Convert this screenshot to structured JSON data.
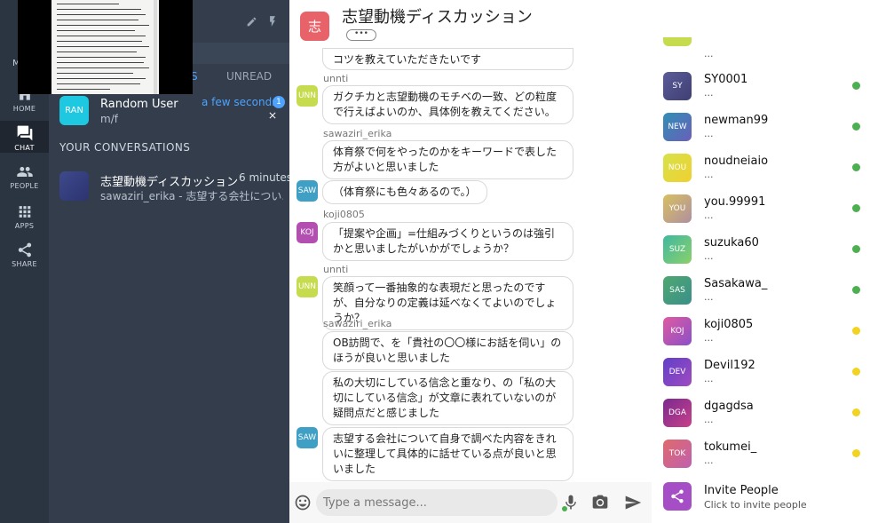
{
  "rail": {
    "partial_label": "M",
    "items": [
      {
        "label": "HOME",
        "icon": "home-icon"
      },
      {
        "label": "CHAT",
        "icon": "chat-icon"
      },
      {
        "label": "PEOPLE",
        "icon": "people-icon"
      },
      {
        "label": "APPS",
        "icon": "apps-icon"
      },
      {
        "label": "SHARE",
        "icon": "share-icon"
      }
    ]
  },
  "conv_panel": {
    "tabs": {
      "partial_all": "S",
      "unread": "UNREAD"
    },
    "random_user": {
      "avatar": "RAN",
      "name": "Random User",
      "sub": "m/f",
      "time": "a few seconds",
      "badge": "1"
    },
    "section_title": "YOUR CONVERSATIONS",
    "conversations": [
      {
        "name": "志望動機ディスカッション",
        "time": "6 minutes",
        "preview": "sawaziri_erika - 志望する会社につい..."
      }
    ]
  },
  "chat": {
    "room_avatar": "志",
    "room_title": "志望動機ディスカッション",
    "room_more": "•••",
    "messages": [
      {
        "text": "コツを教えていただきたいです"
      },
      {
        "sender": "unnti"
      },
      {
        "avatar": "UNN",
        "text": "ガクチカと志望動機のモチベの一致、どの粒度で行えばよいのか、具体例を教えてください。"
      },
      {
        "sender": "sawaziri_erika"
      },
      {
        "text": "体育祭で何をやったのかをキーワードで表した方がよいと思いました"
      },
      {
        "avatar": "SAW",
        "text": "（体育祭にも色々あるので。）"
      },
      {
        "sender": "koji0805"
      },
      {
        "avatar": "KOJ",
        "text": "「提案や企画」=仕組みづくりというのは強引かと思いましたがいかがでしょうか？"
      },
      {
        "sender": "unnti"
      },
      {
        "avatar": "UNN",
        "text": "笑顔って一番抽象的な表現だと思ったのですが、自分なりの定義は延べなくてよいのでしょうか？"
      },
      {
        "sender": "sawaziri_erika"
      },
      {
        "text": "OB訪問で、を「貴社の〇〇様にお話を伺い」のほうが良いと思いました"
      },
      {
        "text": "私の大切にしている信念と重なり、の「私の大切にしている信念」が文章に表れていないのが疑問点だと感じました"
      },
      {
        "avatar": "SAW",
        "text": "志望する会社について自身で調べた内容をきれいに整理して具体的に話せている点が良いと思いました"
      }
    ],
    "composer": {
      "placeholder": "Type a message..."
    }
  },
  "header_tools": {
    "hash": "#"
  },
  "members": {
    "partial_top_sub": "...",
    "list": [
      {
        "avatar": "SY",
        "name": "SY0001",
        "sub": "...",
        "status": "online"
      },
      {
        "avatar": "NEW",
        "name": "newman99",
        "sub": "...",
        "status": "online"
      },
      {
        "avatar": "NOU",
        "name": "noudneiaio",
        "sub": "...",
        "status": "online"
      },
      {
        "avatar": "YOU",
        "name": "you.99991",
        "sub": "...",
        "status": "online"
      },
      {
        "avatar": "SUZ",
        "name": "suzuka60",
        "sub": "...",
        "status": "online"
      },
      {
        "avatar": "SAS",
        "name": "Sasakawa_",
        "sub": "...",
        "status": "online"
      },
      {
        "avatar": "KOJ",
        "name": "koji0805",
        "sub": "...",
        "status": "away"
      },
      {
        "avatar": "DEV",
        "name": "Devil192",
        "sub": "...",
        "status": "away"
      },
      {
        "avatar": "DGA",
        "name": "dgagdsa",
        "sub": "...",
        "status": "away"
      },
      {
        "avatar": "TOK",
        "name": "tokumei_",
        "sub": "...",
        "status": "away"
      }
    ],
    "invite": {
      "title": "Invite People",
      "sub": "Click to invite people"
    }
  },
  "colors": {
    "online": "#4caf50",
    "away": "#f2d321",
    "accent": "#4da3ff",
    "room_avatar": "#e8626a"
  }
}
